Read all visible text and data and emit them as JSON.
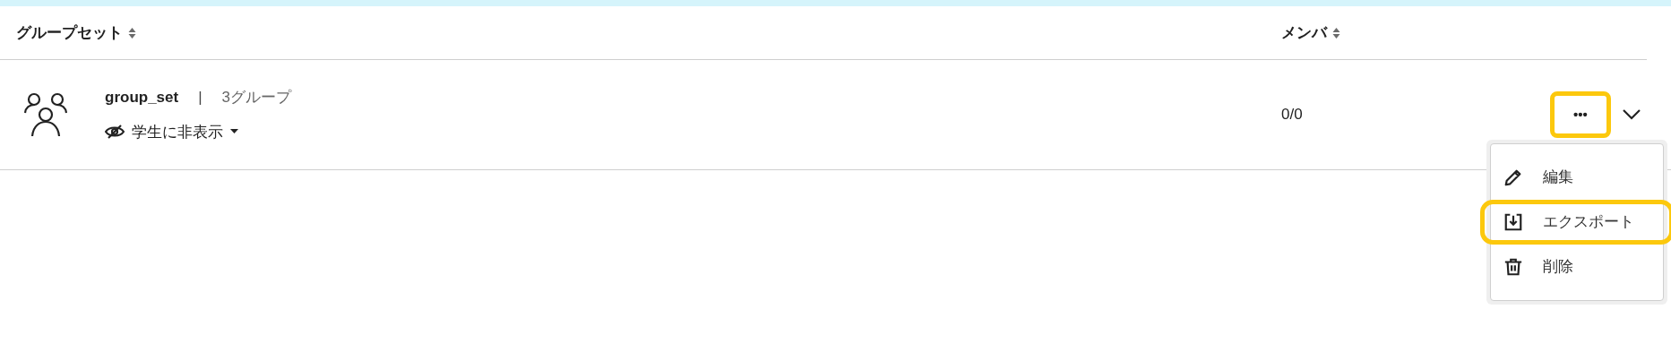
{
  "table": {
    "columns": [
      {
        "label": "グループセット",
        "sortable": true
      },
      {
        "label": "メンバ",
        "sortable": true
      }
    ],
    "rows": [
      {
        "name": "group_set",
        "separator": "|",
        "group_count": "3グループ",
        "visibility": "学生に非表示",
        "members": "0/0",
        "more_button": {
          "label": "•••",
          "highlighted": true
        },
        "expanded": false
      }
    ]
  },
  "menu": {
    "items": [
      {
        "kind": "edit",
        "label": "編集",
        "highlighted": false
      },
      {
        "kind": "export",
        "label": "エクスポート",
        "highlighted": true
      },
      {
        "kind": "delete",
        "label": "削除",
        "highlighted": false
      }
    ]
  }
}
